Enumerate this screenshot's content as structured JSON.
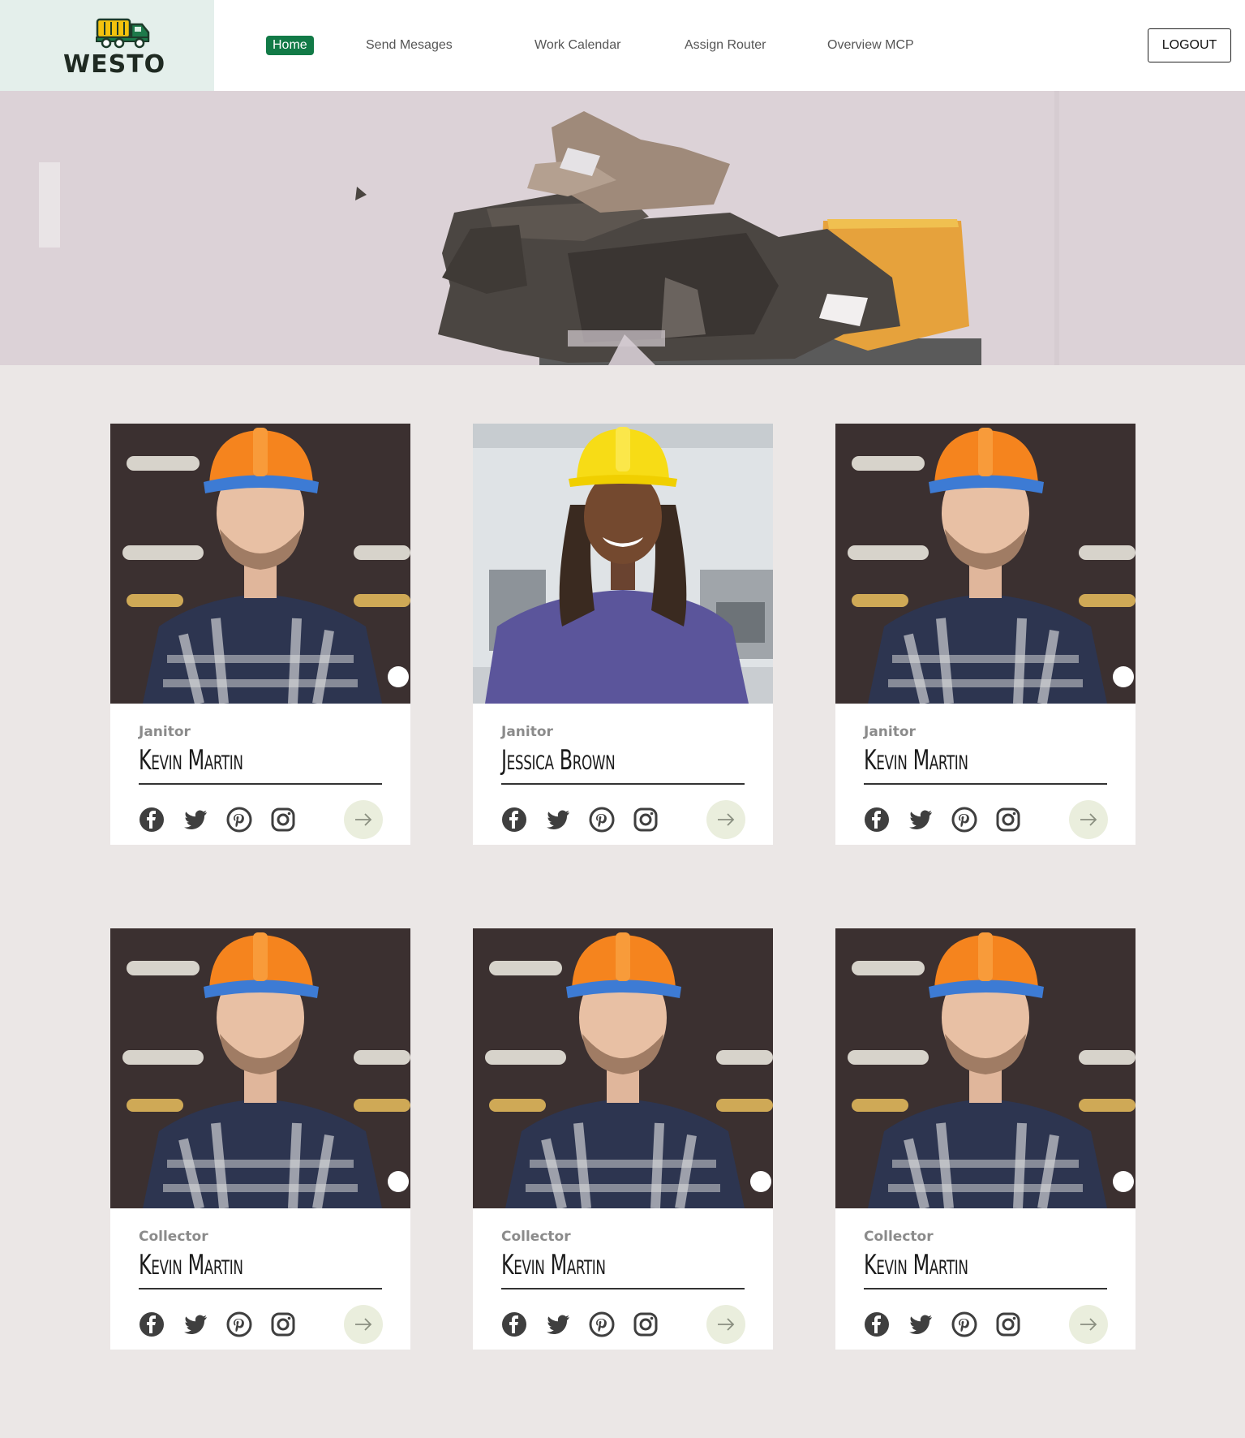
{
  "brand": {
    "name": "WESTO",
    "logo_icon": "garbage-truck-icon",
    "colors": {
      "truck_body": "#f4c20d",
      "truck_cab": "#1d7a4a",
      "nav_active": "#127a47"
    }
  },
  "nav": {
    "items": [
      {
        "label": "Home",
        "active": true
      },
      {
        "label": "Send Mesages",
        "active": false
      },
      {
        "label": "Work Calendar",
        "active": false
      },
      {
        "label": "Assign Router",
        "active": false
      },
      {
        "label": "Overview MCP",
        "active": false
      }
    ],
    "logout_label": "LOGOUT"
  },
  "hero": {
    "image": "cardboard-trash-bin-photo"
  },
  "cards": [
    {
      "role": "Janitor",
      "name": "Kevin Martin",
      "photo": "male-worker-orange-helmet"
    },
    {
      "role": "Janitor",
      "name": "Jessica Brown",
      "photo": "female-worker-yellow-helmet"
    },
    {
      "role": "Janitor",
      "name": "Kevin Martin",
      "photo": "male-worker-orange-helmet"
    },
    {
      "role": "Collector",
      "name": "Kevin Martin",
      "photo": "male-worker-orange-helmet"
    },
    {
      "role": "Collector",
      "name": "Kevin Martin",
      "photo": "male-worker-orange-helmet"
    },
    {
      "role": "Collector",
      "name": "Kevin Martin",
      "photo": "male-worker-orange-helmet"
    }
  ],
  "social_icons": [
    "facebook-icon",
    "twitter-icon",
    "pinterest-icon",
    "instagram-icon"
  ],
  "card_action_icon": "arrow-right-icon"
}
